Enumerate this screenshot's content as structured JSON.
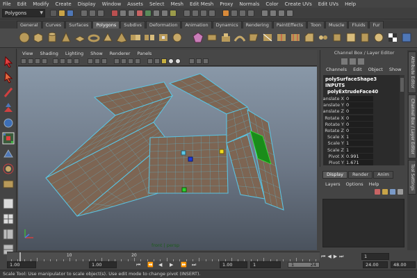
{
  "menubar": {
    "items": [
      "File",
      "Edit",
      "Modify",
      "Create",
      "Display",
      "Window",
      "Assets",
      "Select",
      "Mesh",
      "Edit Mesh",
      "Proxy",
      "Normals",
      "Color",
      "Create UVs",
      "Edit UVs",
      "Help"
    ]
  },
  "statusline": {
    "mode": "Polygons"
  },
  "shelf": {
    "tabs": [
      "General",
      "Curves",
      "Surfaces",
      "Polygons",
      "Subdivs",
      "Deformation",
      "Animation",
      "Dynamics",
      "Rendering",
      "PaintEffects",
      "Toon",
      "Muscle",
      "Fluids",
      "Fur"
    ],
    "active_tab": "Polygons"
  },
  "viewport": {
    "menus": [
      "View",
      "Shading",
      "Lighting",
      "Show",
      "Renderer",
      "Panels"
    ],
    "camera_label": "front | persp"
  },
  "channel_box": {
    "title": "Channel Box / Layer Editor",
    "menus": [
      "Channels",
      "Edit",
      "Object",
      "Show"
    ],
    "object_name": "polySurfaceShape3",
    "inputs_header": "INPUTS",
    "node_name": "polyExtrudeFace40",
    "attributes": [
      {
        "label": "Translate X",
        "value": "0"
      },
      {
        "label": "Translate Y",
        "value": "0"
      },
      {
        "label": "Translate Z",
        "value": "0"
      },
      {
        "label": "Rotate X",
        "value": "0"
      },
      {
        "label": "Rotate Y",
        "value": "0"
      },
      {
        "label": "Rotate Z",
        "value": "0"
      },
      {
        "label": "Scale X",
        "value": "1"
      },
      {
        "label": "Scale Y",
        "value": "1"
      },
      {
        "label": "Scale Z",
        "value": "1"
      },
      {
        "label": "Pivot X",
        "value": "0.991"
      },
      {
        "label": "Pivot Y",
        "value": "1.671"
      }
    ]
  },
  "side_tabs": [
    "Attribute Editor",
    "Channel Box / Layer Editor",
    "Tool Settings"
  ],
  "layer_editor": {
    "tabs": [
      "Display",
      "Render",
      "Anim"
    ],
    "active_tab": "Display",
    "menus": [
      "Layers",
      "Options",
      "Help"
    ]
  },
  "time_slider": {
    "ticks": [
      "10",
      "20"
    ],
    "current_frame": "1"
  },
  "range_slider": {
    "start_time": "1.00",
    "playback_start": "1.00",
    "range_start": "1",
    "range_end": "24",
    "playback_end": "24.00",
    "end_time": "48.00"
  },
  "help_line": "Scale Tool: Use manipulator to scale object(s). Use edit mode to change pivot (INSERT).",
  "colors": {
    "mesh_face": "#7d6553",
    "mesh_wire": "#5bc2e0",
    "selected_face": "#1a8c1a",
    "viewport_top": "#8998a8",
    "viewport_bottom": "#4a525d"
  }
}
